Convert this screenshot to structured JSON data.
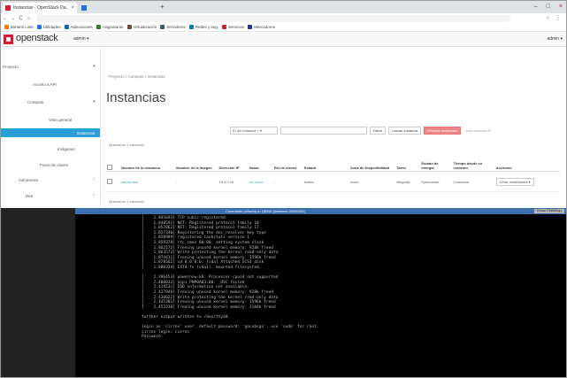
{
  "browser": {
    "tab_active_title": "Instancias - OpenStack Da...",
    "tab_inactive_title": "",
    "close_glyph": "×",
    "newtab_glyph": "+",
    "url": "",
    "nav_back": "←",
    "nav_forward": "→",
    "nav_reload": "C",
    "nav_home": "⌂",
    "min_glyph": "–",
    "max_glyph": "□",
    "win_close_glyph": "×",
    "star_glyph": "☆",
    "menu_glyph": "⋮",
    "bookmarks": [
      {
        "label": "Bitnami Liste",
        "color": "#f57c00"
      },
      {
        "label": "Utilidades",
        "color": "#1a73e8"
      },
      {
        "label": "Aplicaciones",
        "color": "#1565c0"
      },
      {
        "label": "Asignaturas",
        "color": "#2e7d32"
      },
      {
        "label": "Virtualización",
        "color": "#6d4c41"
      },
      {
        "label": "Servidores",
        "color": "#455a64"
      },
      {
        "label": "Redes y seg.",
        "color": "#0277bd"
      },
      {
        "label": "Servicios",
        "color": "#c62828"
      },
      {
        "label": "Marcadores",
        "color": "#283593"
      }
    ]
  },
  "header": {
    "logo_text": "openstack",
    "project_label": "admin ▾",
    "user_label": "admin ▾"
  },
  "sidebar": {
    "items": [
      {
        "label": "Proyecto",
        "chevron": "▾"
      },
      {
        "label": "Acceso a API",
        "chevron": ""
      },
      {
        "label": "Compute",
        "chevron": "▾"
      },
      {
        "label": "Vista general",
        "chevron": ""
      },
      {
        "label": "Instancias",
        "chevron": ""
      },
      {
        "label": "Imágenes",
        "chevron": ""
      },
      {
        "label": "Pares de claves",
        "chevron": ""
      },
      {
        "label": "Volúmenes",
        "chevron": "›"
      },
      {
        "label": "Red",
        "chevron": "›"
      }
    ]
  },
  "main": {
    "breadcrumb": "Proyecto / Compute / Instancias",
    "title": "Instancias",
    "filter_select": "ID de instancia = ▾",
    "filter_placeholder": "",
    "filter_button": "Filtrar",
    "launch_button": "Lanzar instancia",
    "delete_button": "Eliminar instancias",
    "more_button": "Más acciones ▾",
    "count_text": "Mostrando 1 elemento",
    "columns": [
      "",
      "Nombre de la instancia",
      "Nombre de la imagen",
      "Dirección IP",
      "Sabor",
      "Par de claves",
      "Estado",
      "",
      "Zona de Disponibilidad",
      "Tarea",
      "Estado de energía",
      "Tiempo desde su creación",
      "Acciones"
    ],
    "rows": [
      [
        "",
        "server-test",
        "-",
        "10.0.0.15",
        "m1.nano",
        "-",
        "Activo",
        "",
        "nova",
        "Ninguna",
        "Ejecutando",
        "0 minutos",
        "Crear instantánea ▾"
      ]
    ]
  },
  "console": {
    "title": "Conectado (cifrado) a: QEMU (instance-00000001)",
    "send_cad": "Enviar CtrlAltSupr",
    "lines": [
      "[    1.845693] TCP cubic registered",
      "[    1.848591] NET: Registered protocol family 10",
      "[    1.857062] NET: Registered protocol family 17",
      "[    1.857340] Registering the dns_resolver key type",
      "[    1.858989] registered taskstats version 1",
      "[    1.859378] rtc_cmos 00:00: setting system clock",
      "[    1.862172] Freeing unused kernel memory: 928k freed",
      "[    1.863572] Write protecting the kernel read-only data",
      "[    1.874411] Freeing unused kernel memory: 1596k freed",
      "[    1.878562] sd 0:0:0:0: [sda] Attached SCSI disk",
      "[    1.880334] EXT4-fs (vda1): mounted filesystem",
      "",
      "[    2.396453] powernow-k8: Processor cpuid not supported",
      "[    2.408032] acpi PNP0A03:00: _OSC failed",
      "[    2.414531] EDD information not available.",
      "[    2.427946] Freeing unused kernel memory: 928k freed",
      "[    2.430022] Write protecting the kernel read-only data",
      "[    2.445301] Freeing unused kernel memory: 1596k freed",
      "[    2.453210] Freeing unused kernel memory: 1184k freed",
      "",
      "further output written to /dev/ttyS0",
      "",
      "login as 'cirros' user. default password: 'gocubsgo'. use 'sudo' for root.",
      "cirros login: cirros",
      "Password: "
    ]
  }
}
